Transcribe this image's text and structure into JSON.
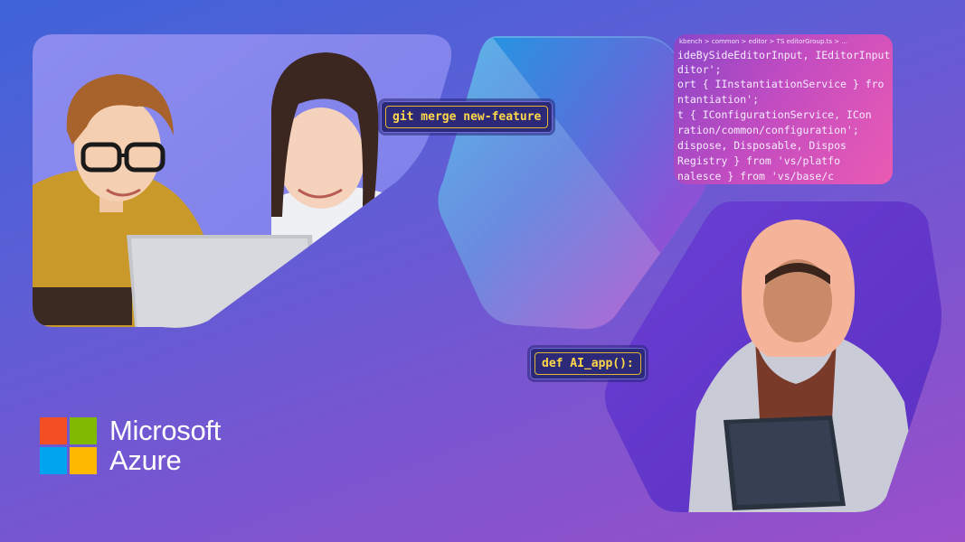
{
  "brand": {
    "name_line1": "Microsoft",
    "name_line2": "Azure",
    "logo_colors": [
      "#f25022",
      "#7fba00",
      "#00a4ef",
      "#ffb900"
    ]
  },
  "code_tags": {
    "git": "git merge new-feature",
    "def": "def AI_app():"
  },
  "code_editor": {
    "breadcrumb": "kbench > common > editor > TS editorGroup.ts > ...",
    "lines": [
      "ideBySideEditorInput, IEditorInput,",
      "ditor';",
      "ort { IInstantiationService } fro",
      "ntantiation';",
      "t { IConfigurationService, ICon",
      "ration/common/configuration';",
      " dispose, Disposable, Dispos",
      "Registry } from 'vs/platfo",
      "nalesce } from 'vs/base/c"
    ]
  },
  "colors": {
    "bg_top": "#3f63d8",
    "bg_bottom": "#9a4fc9",
    "tag_text": "#ffd84a",
    "tag_border": "#e0b63a"
  }
}
